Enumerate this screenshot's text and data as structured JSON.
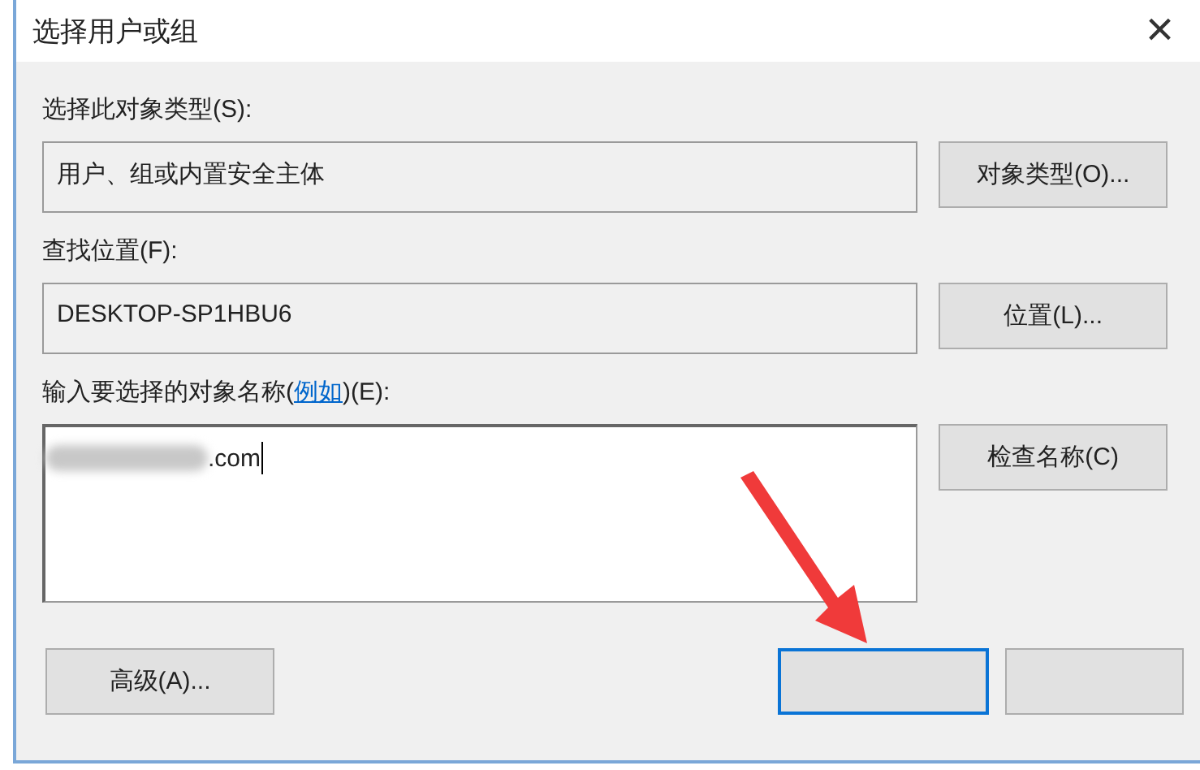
{
  "window": {
    "title": "选择用户或组",
    "close": "×"
  },
  "object_type": {
    "label": "选择此对象类型(S):",
    "value": "用户、组或内置安全主体",
    "button": "对象类型(O)..."
  },
  "location": {
    "label": "查找位置(F):",
    "value": "DESKTOP-SP1HBU6",
    "button": "位置(L)..."
  },
  "names": {
    "label_before": "输入要选择的对象名称(",
    "link": "例如",
    "label_after": ")(E):",
    "value": ".com",
    "button": "检查名称(C)"
  },
  "footer": {
    "advanced": "高级(A)...",
    "ok_focused": true
  }
}
